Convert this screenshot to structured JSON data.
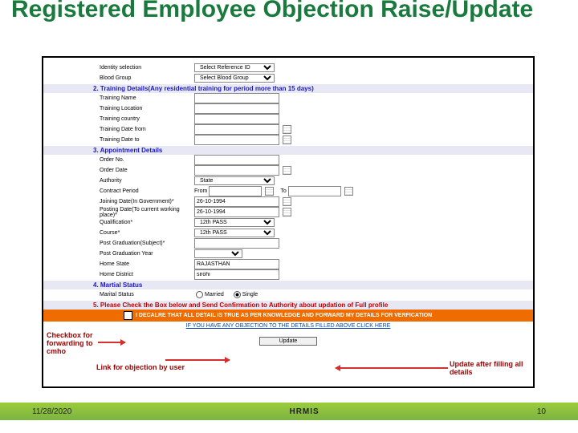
{
  "title": "Registered Employee Objection Raise/Update",
  "footer": {
    "date": "11/28/2020",
    "center": "HRMIS",
    "page": "10"
  },
  "form": {
    "identity_label": "Identity selection",
    "identity_value": "Select Reference ID",
    "blood_label": "Blood Group",
    "blood_value": "Select Blood Group",
    "sect2": "2. Training Details(Any residential training for period more than 15 days)",
    "t_name": "Training Name",
    "t_loc": "Training Location",
    "t_country": "Training country",
    "t_from": "Training Date from",
    "t_to": "Training Date to",
    "sect3": "3. Appointment Details",
    "order_no": "Order No.",
    "order_date": "Order Date",
    "authority": "Authority",
    "state_opt": "State",
    "contract": "Contract Period",
    "from_lbl": "From",
    "to_lbl": "To",
    "joining": "Joining Date(In Government)*",
    "joining_val": "26-10-1994",
    "posting": "Posting Date(To current working place)*",
    "posting_val": "26-10-1994",
    "qual": "Qualification*",
    "qual_val": "12th PASS",
    "course": "Course*",
    "course_val": "12th PASS",
    "pg": "Post Graduation(Subject)*",
    "pg_year": "Post Graduation Year",
    "home_state": "Home State",
    "home_state_val": "RAJASTHAN",
    "home_dist": "Home District",
    "home_dist_val": "sirohi",
    "sect4": "4. Martial Status",
    "marital_lbl": "Marital Status",
    "married": "Married",
    "single": "Single",
    "sect5": "5. Please Check the Box below and Send Confirmation to Authority about updation of Full profile",
    "declare": "I DECALRE THAT ALL DETAIL IS TRUE AS PER KNOWLEDGE AND FORWARD MY DETAILS FOR VERFICATION",
    "obj_link": "IF YOU HAVE ANY OBJECTION TO THE DETAILS FILLED ABOVE CLICK HERE",
    "update_btn": "Update"
  },
  "annot": {
    "a1": "Checkbox for forwarding to cmho",
    "a2": "Link for objection by user",
    "a3": "Update after filling all details"
  }
}
